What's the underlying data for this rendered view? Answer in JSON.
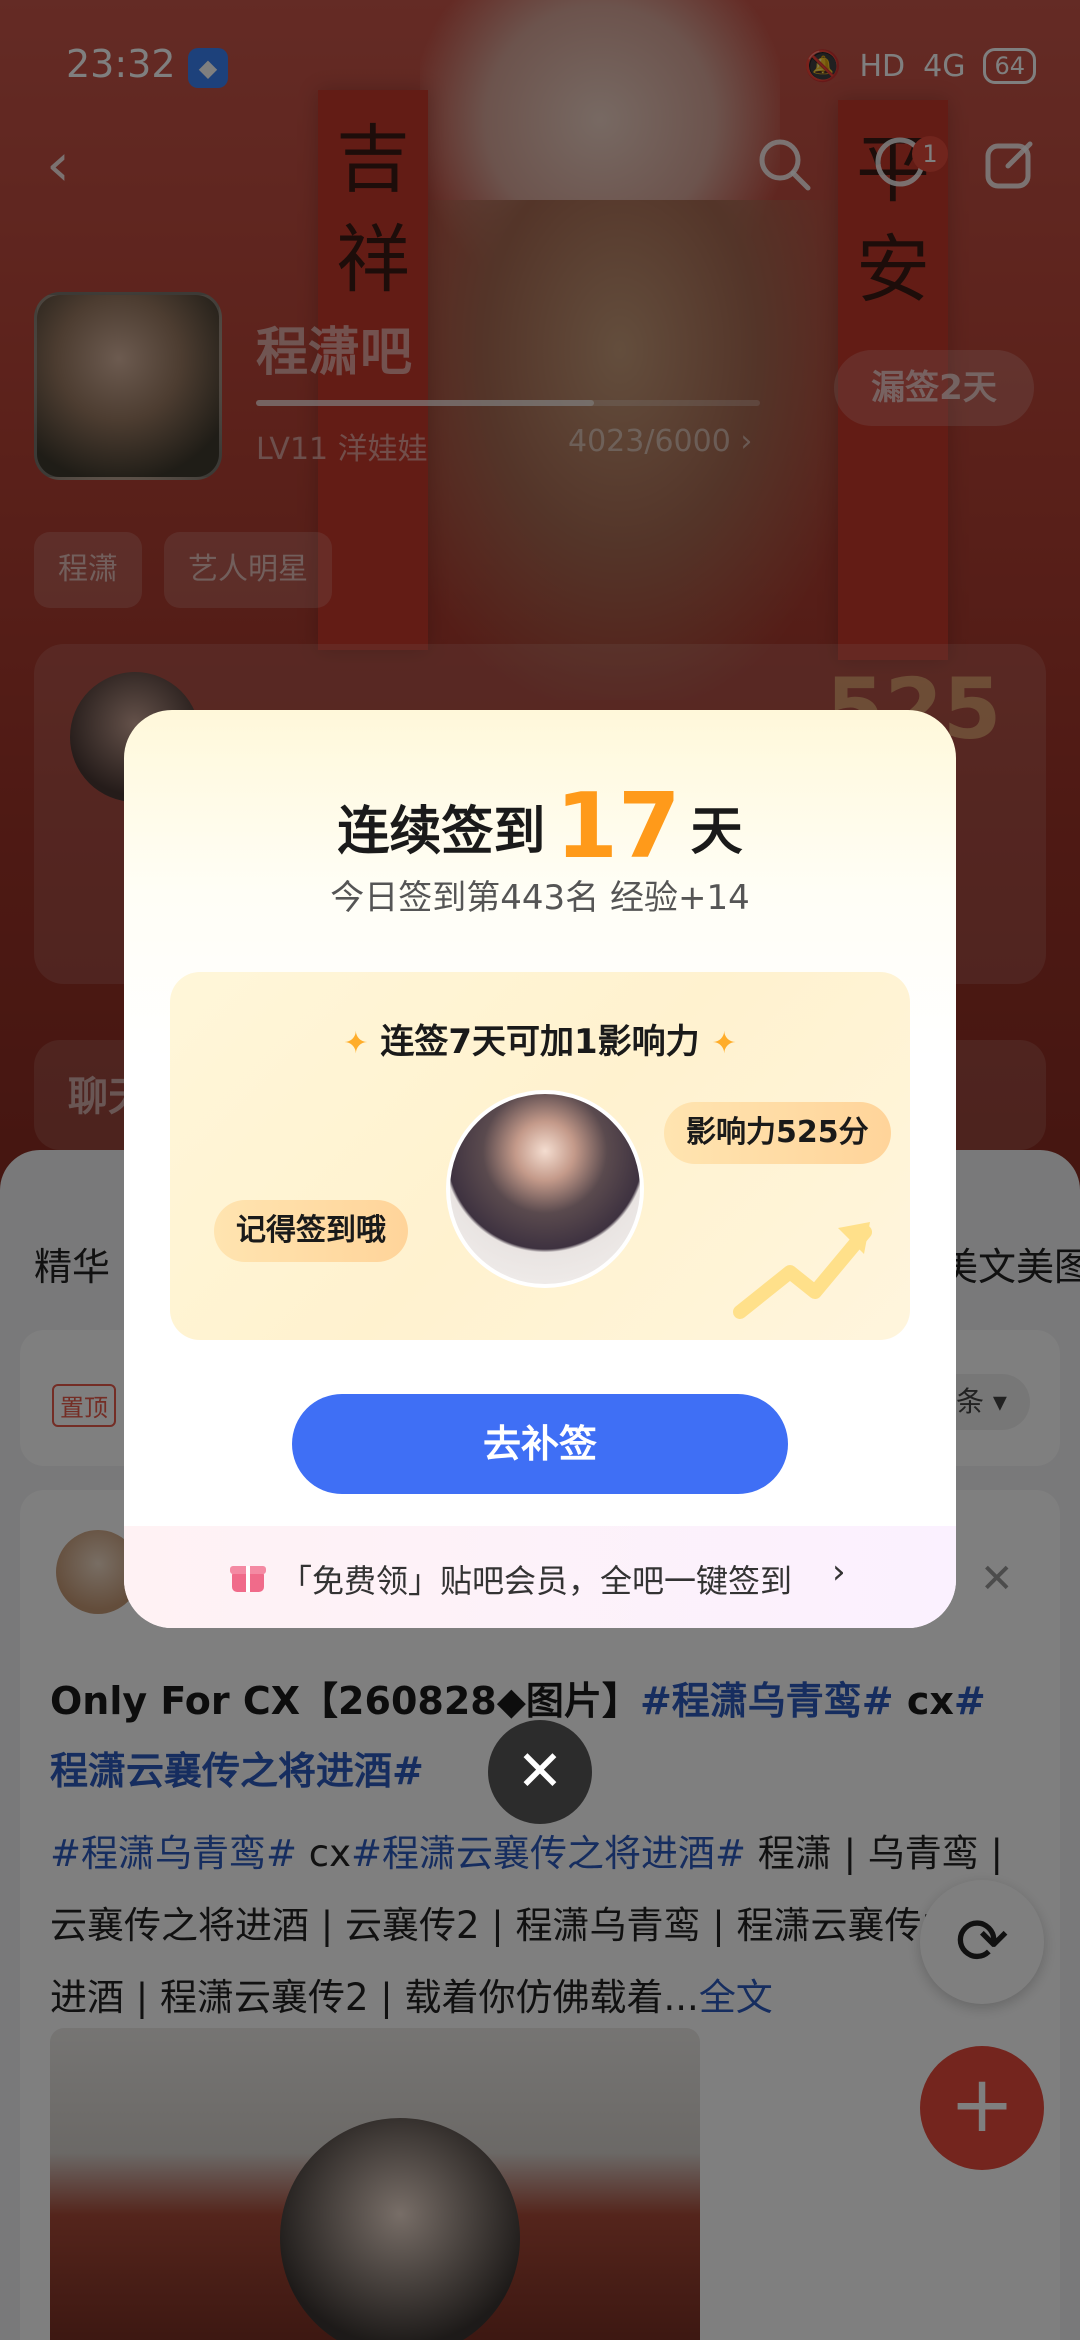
{
  "statusbar": {
    "time": "23:32",
    "network": "HD",
    "signal": "4G",
    "battery": "64"
  },
  "header": {
    "forum_name": "程潇吧",
    "level": "LV11 洋娃娃",
    "exp": "4023/6000",
    "exp_progress": 0.67,
    "leak_button": "漏签2天",
    "message_badge": "1",
    "banner_left": "吉祥",
    "banner_right": "平安"
  },
  "tags": [
    "程潇",
    "艺人明星"
  ],
  "rank": {
    "score": "525"
  },
  "chat": {
    "title": "聊天"
  },
  "tabs": {
    "left": "精华",
    "right": "美文美图"
  },
  "pinned": {
    "badge": "置顶",
    "sort": "条"
  },
  "post": {
    "title_text": "Only For CX【260828◆图片】",
    "title_hash1": "#程潇乌青鸾#",
    "title_mid": " cx",
    "title_hash2": "#程潇云襄传之将进酒#",
    "body_hash1": "#程潇乌青鸾#",
    "body_mid": " cx",
    "body_hash2": "#程潇云襄传之将进酒#",
    "body_text": " 程潇 | 乌青鸾 | 云襄传之将进酒 | 云襄传2 | 程潇乌青鸾 | 程潇云襄传之将进酒 | 程潇云襄传2 | 载着你仿佛载着...",
    "more": "全文"
  },
  "modal": {
    "title_prefix": "连续签到",
    "days": "17",
    "title_suffix": "天",
    "subtitle": "今日签到第443名 经验+14",
    "promo_heading": "连签7天可加1影响力",
    "remind_bubble": "记得签到哦",
    "influence_bubble": "影响力525分",
    "makeup_button": "去补签",
    "footer_text": "「免费领」贴吧会员，全吧一键签到",
    "footer_chevron": "›"
  },
  "icons": {
    "back": "chevron-left-icon",
    "search": "search-icon",
    "message": "message-icon",
    "share": "share-icon",
    "close": "close-icon",
    "refresh": "refresh-icon",
    "add": "plus-icon",
    "gift": "gift-icon"
  },
  "colors": {
    "accent": "#3f6ff5",
    "days": "#ff9a1a",
    "fab": "#e94b3c",
    "hashtag": "#2d5bbf"
  }
}
